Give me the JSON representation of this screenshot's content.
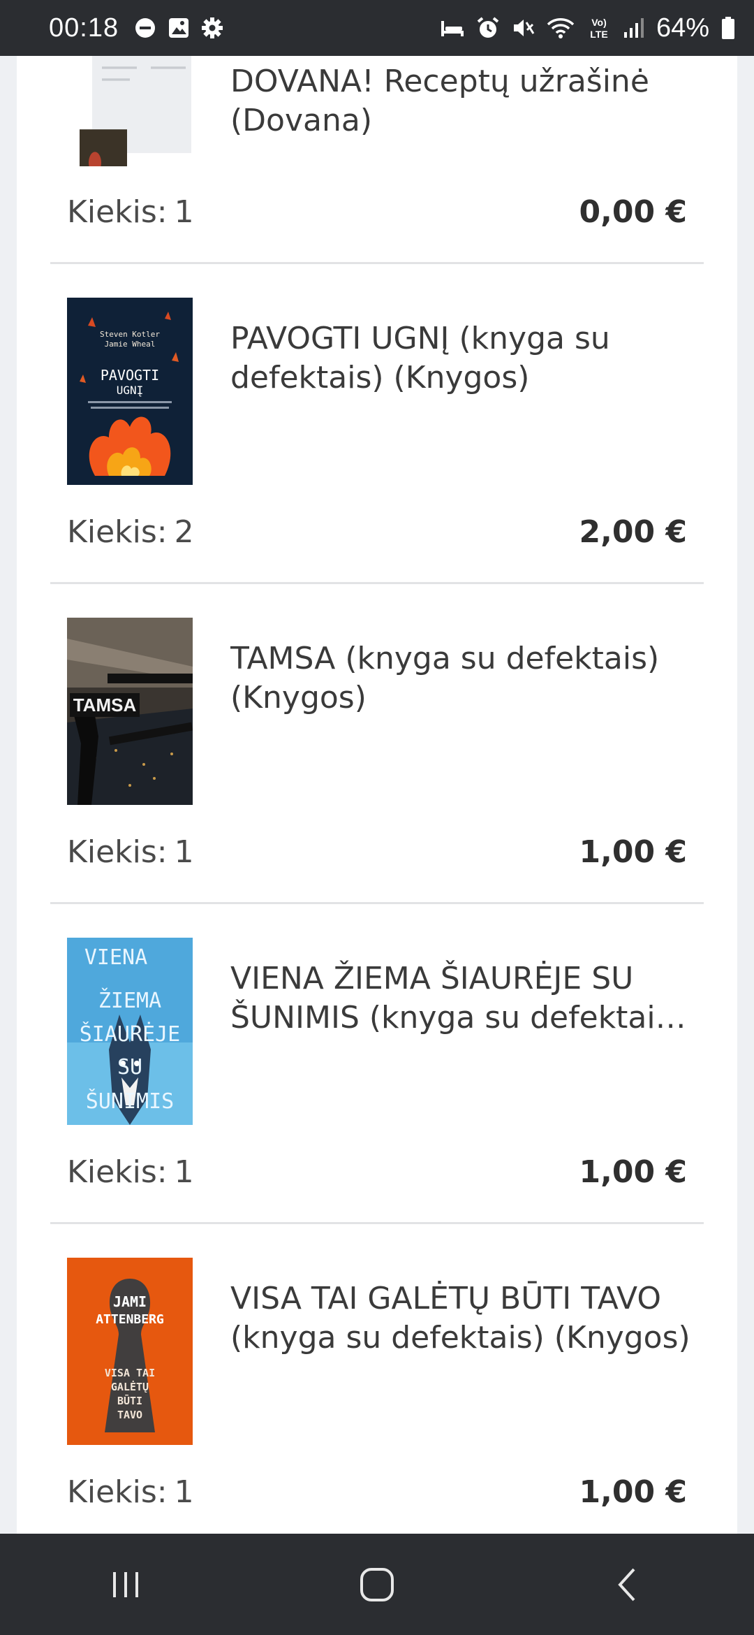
{
  "status_bar": {
    "time": "00:18",
    "battery": "64%",
    "left_icons": [
      "do-not-disturb-icon",
      "gallery-icon",
      "settings-icon"
    ],
    "right_icons": [
      "bed-icon",
      "alarm-icon",
      "mute-icon",
      "wifi-icon",
      "volte-icon",
      "signal-icon",
      "battery-icon"
    ],
    "network_label": "Vo) LTE"
  },
  "cart": {
    "qty_label": "Kiekis:",
    "items": [
      {
        "title": "DOVANA! Receptų užrašinė (Dovana)",
        "qty": "1",
        "price": "0,00 €"
      },
      {
        "title": "PAVOGTI UGNĮ (knyga su defektais) (Knygos)",
        "qty": "2",
        "price": "2,00 €",
        "cover": {
          "authors": "Steven Kotler Jamie Wheal",
          "title": "PAVOGTI UGNĮ"
        }
      },
      {
        "title": "TAMSA (knyga su defektais) (Knygos)",
        "qty": "1",
        "price": "1,00 €",
        "cover": {
          "title": "TAMSA"
        }
      },
      {
        "title": "VIENA ŽIEMA ŠIAURĖJE SU ŠUNIMIS (knyga su defektais) (Knygos)",
        "qty": "1",
        "price": "1,00 €",
        "cover": {
          "title": "VIENA ŽIEMA ŠIAURĖJE SU ŠUNIMIS"
        }
      },
      {
        "title": "VISA TAI GALĖTŲ BŪTI TAVO (knyga su defektais) (Knygos)",
        "qty": "1",
        "price": "1,00 €",
        "cover": {
          "author": "JAMI ATTENBERG",
          "title": "VISA TAI GALĖTŲ BŪTI TAVO"
        }
      }
    ]
  },
  "nav_bar": {
    "buttons": [
      "recent-apps-icon",
      "home-icon",
      "back-icon"
    ]
  },
  "colors": {
    "status_bar_bg": "#2b2d31",
    "divider": "#e2e3e5",
    "cover_pavogti_bg": "#0f2137",
    "cover_viena_bg": "#4fa8dc",
    "cover_visa_bg": "#e6580f"
  }
}
